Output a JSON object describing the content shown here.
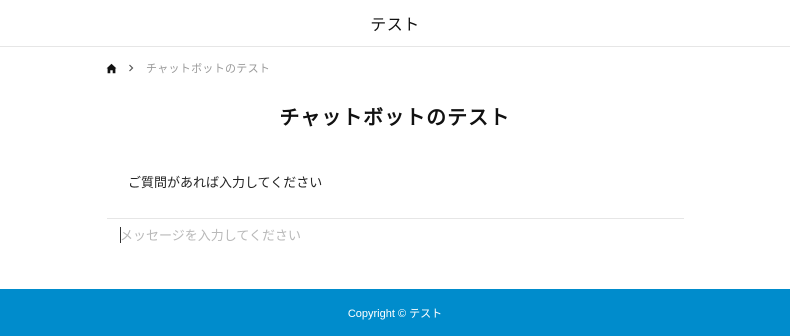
{
  "header": {
    "site_title": "テスト"
  },
  "breadcrumb": {
    "home_icon": "home-icon",
    "separator_icon": "chevron-right-icon",
    "current": "チャットボットのテスト"
  },
  "main": {
    "title": "チャットボットのテスト",
    "prompt": "ご質問があれば入力してください",
    "input_placeholder": "メッセージを入力してください"
  },
  "footer": {
    "copyright": "Copyright © テスト",
    "background_color": "#008ccc"
  }
}
